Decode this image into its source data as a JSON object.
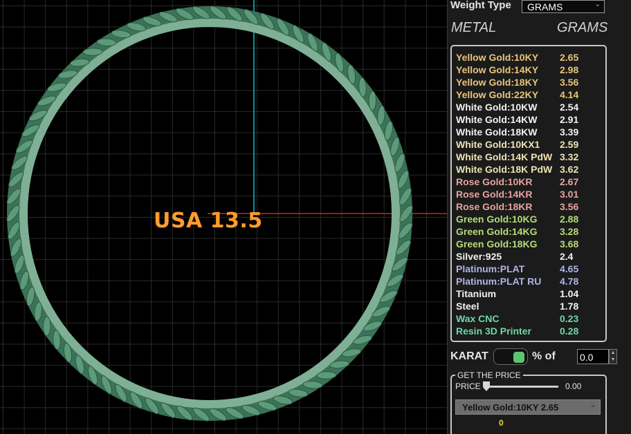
{
  "viewport": {
    "size_label": "USA 13.5",
    "colors": {
      "grid": "#2a2a2a",
      "axis_vertical": "#1fb8c8",
      "axis_horizontal": "#c42a14",
      "ring": "#4f8a6c",
      "label": "#ff9c2e"
    }
  },
  "panel": {
    "weight_type_label": "Weight Type",
    "weight_type_value": "GRAMS",
    "header_metal": "METAL",
    "header_grams": "GRAMS",
    "metals": [
      {
        "name": "Yellow Gold:10KY",
        "grams": "2.65",
        "color": "#e8c57a"
      },
      {
        "name": "Yellow Gold:14KY",
        "grams": "2.98",
        "color": "#e8c57a"
      },
      {
        "name": "Yellow Gold:18KY",
        "grams": "3.56",
        "color": "#e8c57a"
      },
      {
        "name": "Yellow Gold:22KY",
        "grams": "4.14",
        "color": "#e8c57a"
      },
      {
        "name": "White Gold:10KW",
        "grams": "2.54",
        "color": "#f2f2f2"
      },
      {
        "name": "White Gold:14KW",
        "grams": "2.91",
        "color": "#f2f2f2"
      },
      {
        "name": "White Gold:18KW",
        "grams": "3.39",
        "color": "#f2f2f2"
      },
      {
        "name": "White Gold:10KX1",
        "grams": "2.59",
        "color": "#ece4b4"
      },
      {
        "name": "White Gold:14K PdW",
        "grams": "3.32",
        "color": "#ece4b4"
      },
      {
        "name": "White Gold:18K PdW",
        "grams": "3.62",
        "color": "#ece4b4"
      },
      {
        "name": "Rose Gold:10KR",
        "grams": "2.67",
        "color": "#e6a3a0"
      },
      {
        "name": "Rose Gold:14KR",
        "grams": "3.01",
        "color": "#e6a3a0"
      },
      {
        "name": "Rose Gold:18KR",
        "grams": "3.56",
        "color": "#e6a3a0"
      },
      {
        "name": "Green Gold:10KG",
        "grams": "2.88",
        "color": "#b4dc78"
      },
      {
        "name": "Green Gold:14KG",
        "grams": "3.28",
        "color": "#b4dc78"
      },
      {
        "name": "Green Gold:18KG",
        "grams": "3.68",
        "color": "#b4dc78"
      },
      {
        "name": "Silver:925",
        "grams": "2.4",
        "color": "#f2f2f2"
      },
      {
        "name": "Platinum:PLAT",
        "grams": "4.65",
        "color": "#b0b4e6"
      },
      {
        "name": "Platinum:PLAT RU",
        "grams": "4.78",
        "color": "#b0b4e6"
      },
      {
        "name": "Titanium",
        "grams": "1.04",
        "color": "#f2f2f2"
      },
      {
        "name": "Steel",
        "grams": "1.78",
        "color": "#f2f2f2"
      },
      {
        "name": "Wax  CNC",
        "grams": "0.23",
        "color": "#6ed8a8"
      },
      {
        "name": "Resin 3D Printer",
        "grams": "0.28",
        "color": "#6ed8a8"
      }
    ],
    "karat_label": "KARAT",
    "karat_toggle_on": true,
    "percent_of_label": "% of",
    "percent_of_value": "0.0",
    "get_price_legend": "GET THE PRICE",
    "price_label": "PRICE",
    "price_slider_fraction": 0.0,
    "price_value": "0.00",
    "selected_metal": "Yellow Gold:10KY 2.65",
    "price_result": "0"
  }
}
